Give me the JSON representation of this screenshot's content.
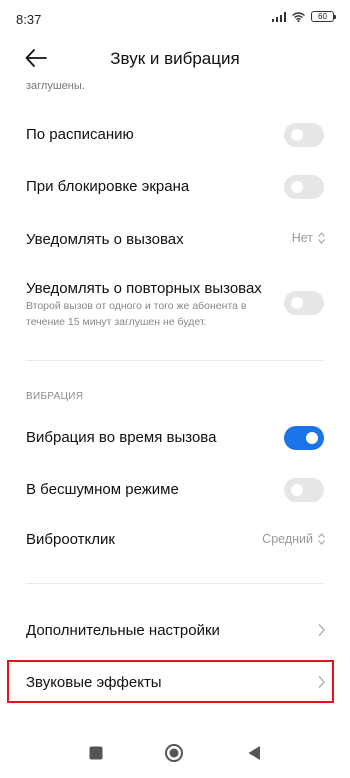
{
  "status_bar": {
    "time": "8:37",
    "battery": "60",
    "icons": [
      "signal-icon",
      "wifi-icon",
      "battery-icon"
    ]
  },
  "header": {
    "title": "Звук и вибрация",
    "back_icon": "arrow-left-icon"
  },
  "clipped_note": "заглушены.",
  "settings": {
    "schedule": {
      "label": "По расписанию",
      "enabled": false
    },
    "on_lock": {
      "label": "При блокировке экрана",
      "enabled": false
    },
    "notify_calls": {
      "label": "Уведомлять о вызовах",
      "value": "Нет"
    },
    "notify_repeat": {
      "label": "Уведомлять о повторных вызовах",
      "description": "Второй вызов от одного и того же абонента в течение 15 минут заглушен не будет.",
      "enabled": false
    }
  },
  "vibration_section": {
    "header": "ВИБРАЦИЯ",
    "during_call": {
      "label": "Вибрация во время вызова",
      "enabled": true
    },
    "silent_mode": {
      "label": "В бесшумном режиме",
      "enabled": false
    },
    "haptic": {
      "label": "Виброотклик",
      "value": "Средний"
    }
  },
  "more": {
    "additional": {
      "label": "Дополнительные настройки"
    },
    "sound_effects": {
      "label": "Звуковые эффекты",
      "highlighted": true
    }
  },
  "colors": {
    "accent": "#1a73e8",
    "toggle_off": "#e6e6e6",
    "highlight": "#e8111a"
  },
  "nav_bar": [
    "recents-square-icon",
    "home-circle-icon",
    "back-triangle-icon"
  ]
}
